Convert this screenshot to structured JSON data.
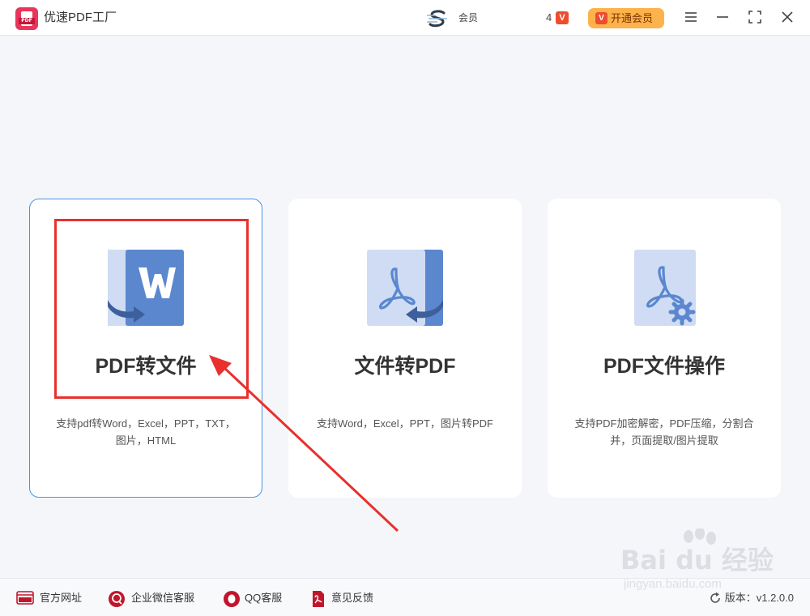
{
  "app": {
    "title": "优速PDF工厂",
    "logo_text": "PDF"
  },
  "header": {
    "user_name": "会员",
    "points": "4",
    "vip_button_label": "开通会员",
    "window_controls": [
      "menu-icon",
      "minimize-icon",
      "maximize-icon",
      "close-icon"
    ]
  },
  "cards": [
    {
      "title": "PDF转文件",
      "desc_line1": "支持pdf转Word，Excel，PPT，TXT，",
      "desc_line2": "图片，HTML",
      "icon": "pdf-to-word-icon",
      "selected": true
    },
    {
      "title": "文件转PDF",
      "desc_line1": "支持Word，Excel，PPT，图片转PDF",
      "desc_line2": "",
      "icon": "file-to-pdf-icon",
      "selected": false
    },
    {
      "title": "PDF文件操作",
      "desc_line1": "支持PDF加密解密，PDF压缩，分割合",
      "desc_line2": "并，页面提取/图片提取",
      "icon": "pdf-operation-icon",
      "selected": false
    }
  ],
  "footer": {
    "links": [
      {
        "label": "官方网址",
        "icon": "website-icon"
      },
      {
        "label": "企业微信客服",
        "icon": "wechat-service-icon"
      },
      {
        "label": "QQ客服",
        "icon": "qq-icon"
      },
      {
        "label": "意见反馈",
        "icon": "feedback-icon"
      }
    ],
    "version": "版本：v1.2.0.0"
  },
  "watermark": {
    "brand": "Bai du 经验",
    "url": "jingyan.baidu.com"
  },
  "colors": {
    "accent_blue": "#4a92e3",
    "icon_blue": "#5b87cf",
    "icon_light_blue": "#cfdcf3",
    "vip_orange": "#fdb24b",
    "brand_red": "#e8355a",
    "annotation_red": "#e8302c"
  }
}
